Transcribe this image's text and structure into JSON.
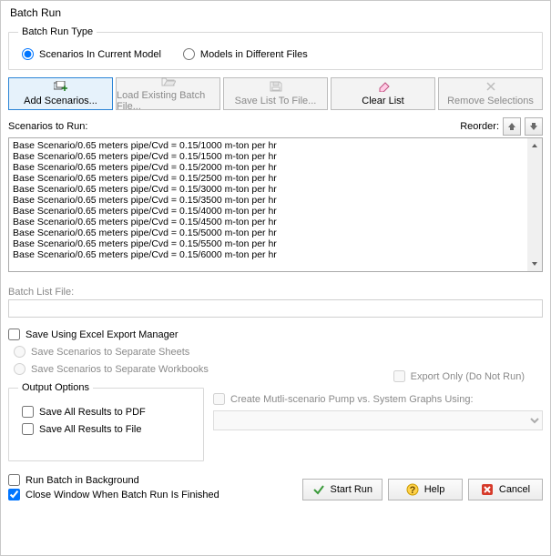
{
  "title": "Batch Run",
  "batch_type": {
    "legend": "Batch Run Type",
    "opt1": "Scenarios In Current Model",
    "opt2": "Models in Different Files"
  },
  "toolbar": {
    "add": "Add Scenarios...",
    "load": "Load Existing Batch File...",
    "save": "Save List To File...",
    "clear": "Clear List",
    "remove": "Remove Selections"
  },
  "scenarios_label": "Scenarios to Run:",
  "reorder_label": "Reorder:",
  "scenarios": [
    "Base Scenario/0.65 meters pipe/Cvd = 0.15/1000 m-ton per hr",
    "Base Scenario/0.65 meters pipe/Cvd = 0.15/1500 m-ton per hr",
    "Base Scenario/0.65 meters pipe/Cvd = 0.15/2000 m-ton per hr",
    "Base Scenario/0.65 meters pipe/Cvd = 0.15/2500 m-ton per hr",
    "Base Scenario/0.65 meters pipe/Cvd = 0.15/3000 m-ton per hr",
    "Base Scenario/0.65 meters pipe/Cvd = 0.15/3500 m-ton per hr",
    "Base Scenario/0.65 meters pipe/Cvd = 0.15/4000 m-ton per hr",
    "Base Scenario/0.65 meters pipe/Cvd = 0.15/4500 m-ton per hr",
    "Base Scenario/0.65 meters pipe/Cvd = 0.15/5000 m-ton per hr",
    "Base Scenario/0.65 meters pipe/Cvd = 0.15/5500 m-ton per hr",
    "Base Scenario/0.65 meters pipe/Cvd = 0.15/6000 m-ton per hr"
  ],
  "batch_list_file": "Batch List File:",
  "excel": {
    "save": "Save Using Excel Export Manager",
    "sheets": "Save Scenarios to Separate Sheets",
    "workbooks": "Save Scenarios to Separate Workbooks",
    "export_only": "Export Only (Do Not Run)"
  },
  "output": {
    "legend": "Output Options",
    "pdf": "Save All Results to PDF",
    "file": "Save All Results to File"
  },
  "ms_graph": "Create Mutli-scenario Pump vs. System Graphs Using:",
  "run_bg": "Run Batch in Background",
  "close_win": "Close Window When Batch Run Is Finished",
  "buttons": {
    "start": "Start Run",
    "help": "Help",
    "cancel": "Cancel"
  }
}
